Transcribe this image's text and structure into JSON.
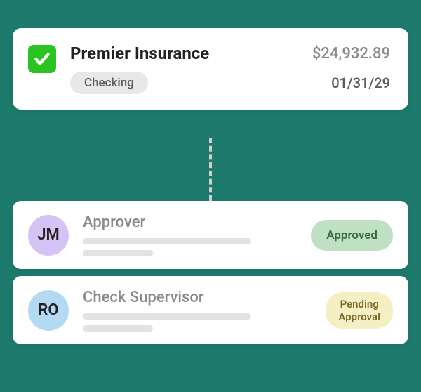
{
  "payment": {
    "payee": "Premier Insurance",
    "amount": "$24,932.89",
    "account_type": "Checking",
    "date": "01/31/29",
    "checked": true
  },
  "approvers": [
    {
      "initials": "JM",
      "role": "Approver",
      "status": "Approved",
      "status_kind": "approved",
      "avatar_color": "purple"
    },
    {
      "initials": "RO",
      "role": "Check Supervisor",
      "status": "Pending\nApproval",
      "status_kind": "pending",
      "avatar_color": "blue"
    }
  ]
}
